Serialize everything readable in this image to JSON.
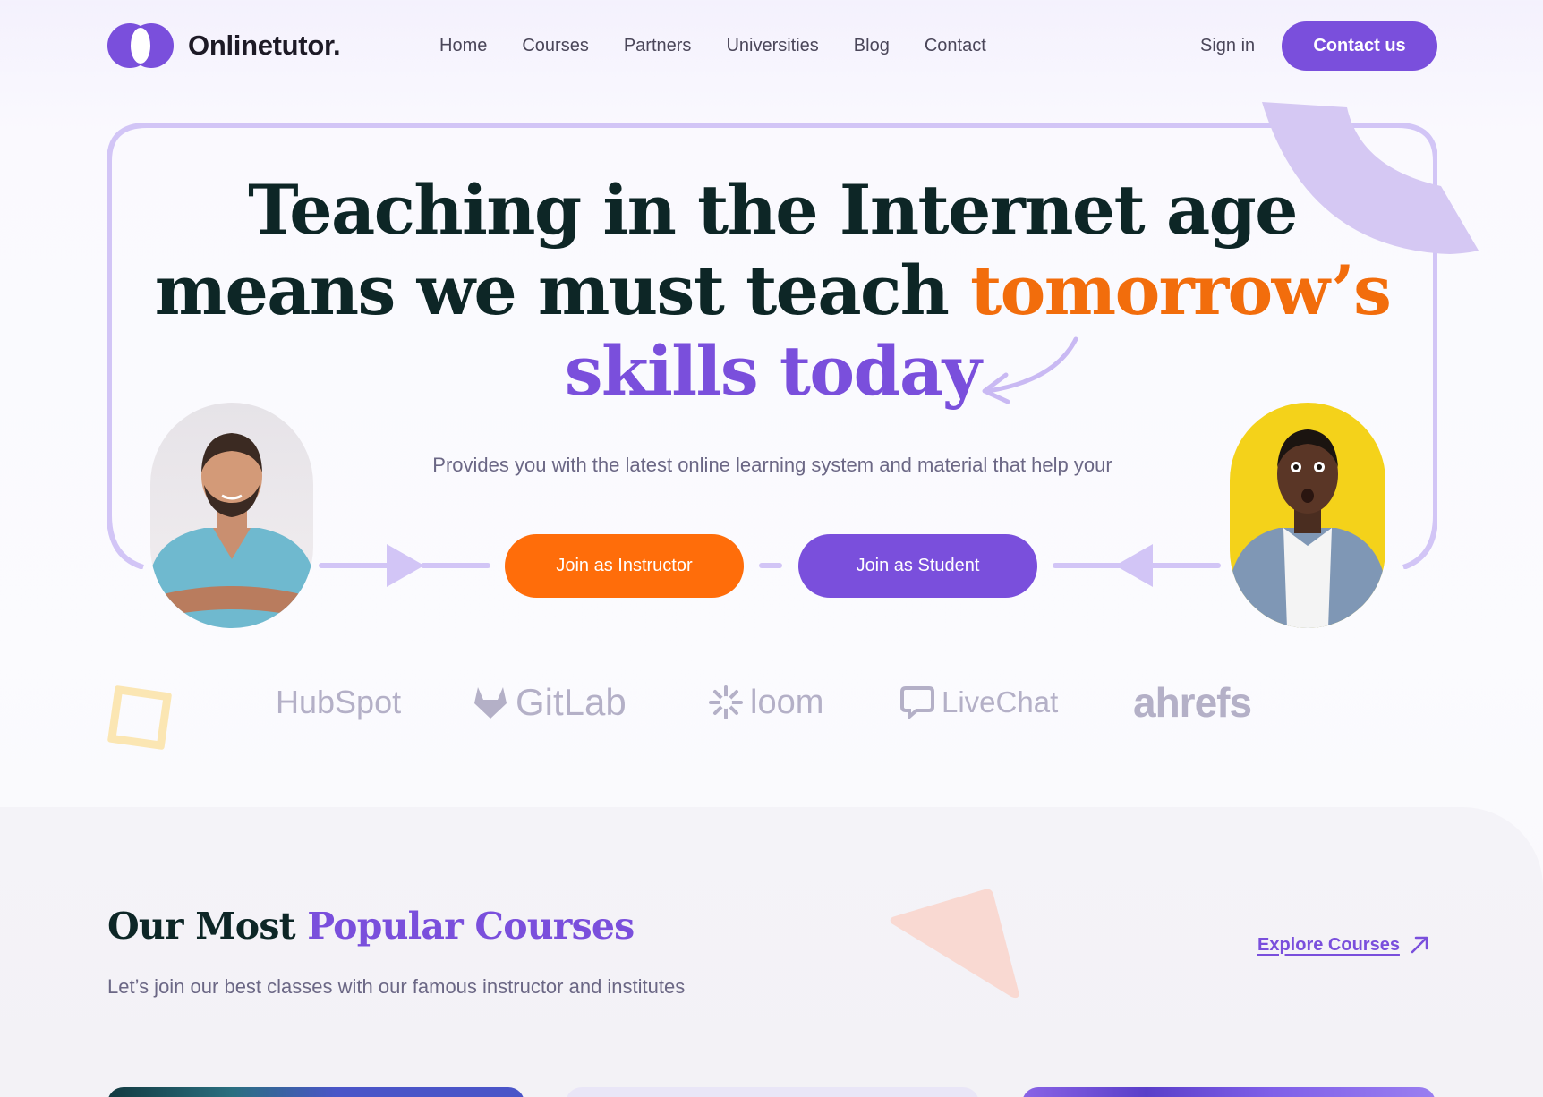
{
  "header": {
    "logo_text": "Onlinetutor.",
    "nav": [
      "Home",
      "Courses",
      "Partners",
      "Universities",
      "Blog",
      "Contact"
    ],
    "signin_label": "Sign in",
    "contact_label": "Contact us"
  },
  "hero": {
    "headline_line1": "Teaching in the Internet age",
    "headline_line2_dark": "means we must teach ",
    "headline_line2_accent": "tomorrow’s",
    "headline_line3": "skills today",
    "subtitle": "Provides you with the latest online learning system and material that help your",
    "instructor_button": "Join as Instructor",
    "student_button": "Join as Student"
  },
  "partners": [
    "HubSpot",
    "GitLab",
    "loom",
    "LiveChat",
    "ahrefs"
  ],
  "courses": {
    "title_dark": "Our Most ",
    "title_accent": "Popular Courses",
    "subtitle": "Let’s join our best classes with our famous instructor and institutes",
    "explore_label": "Explore Courses"
  },
  "colors": {
    "brand_purple": "#7a4fdc",
    "accent_orange": "#f26d0c",
    "heading": "#0d2626",
    "light_purple": "#d2c5f6"
  }
}
